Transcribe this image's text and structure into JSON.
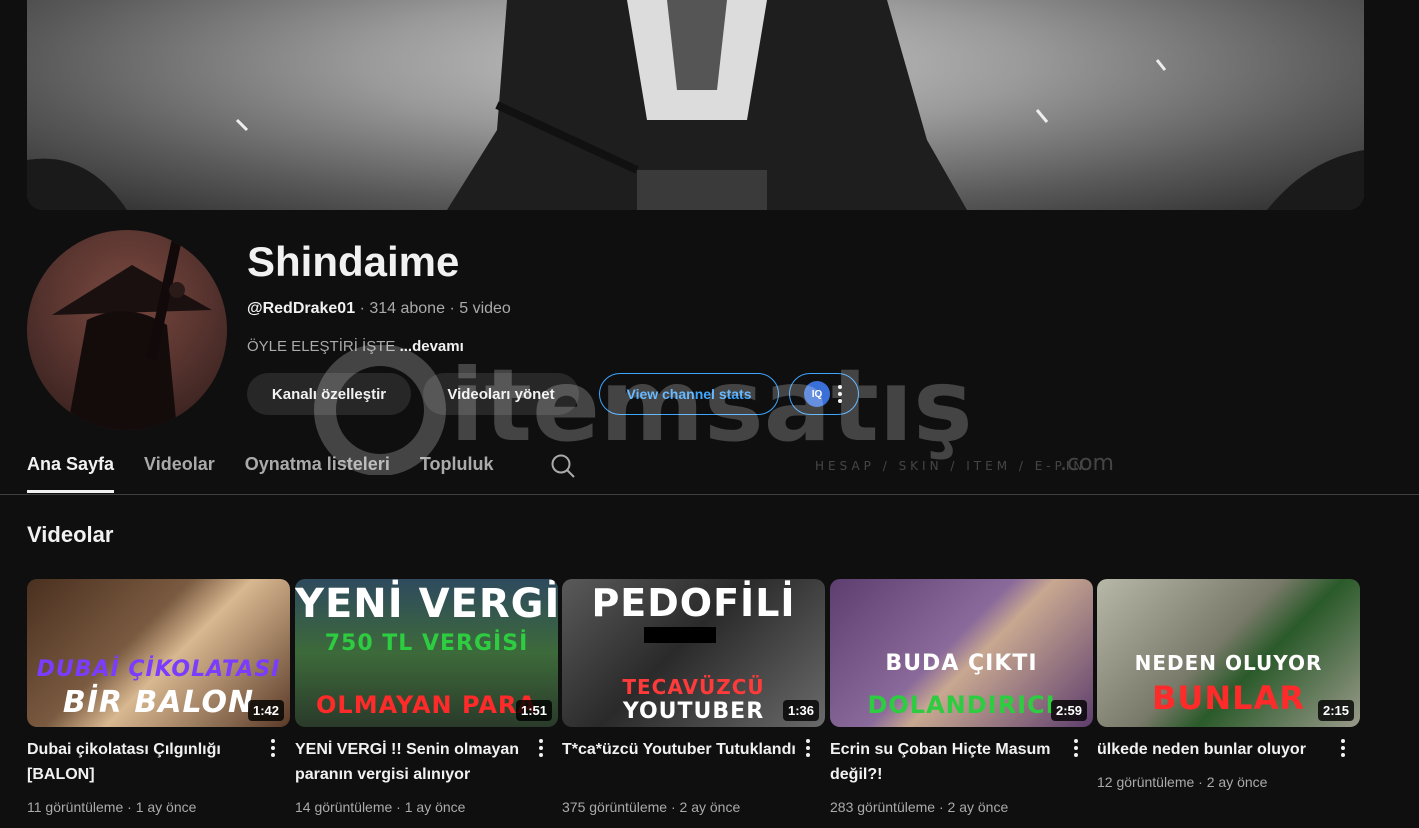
{
  "channel": {
    "name": "Shindaime",
    "handle": "@RedDrake01",
    "subscribers": "314 abone",
    "video_count": "5 video",
    "description": "ÖYLE ELEŞTİRİ İŞTE",
    "more_label": "...devamı"
  },
  "actions": {
    "customize_label": "Kanalı özelleştir",
    "manage_label": "Videoları yönet",
    "stats_label": "View channel stats",
    "extension_badge": "IQ"
  },
  "tabs": [
    {
      "label": "Ana Sayfa",
      "active": true
    },
    {
      "label": "Videolar",
      "active": false
    },
    {
      "label": "Oynatma listeleri",
      "active": false
    },
    {
      "label": "Topluluk",
      "active": false
    }
  ],
  "section_title": "Videolar",
  "watermark": {
    "brand": "itemsatış",
    "tagline": "HESAP / SKIN / ITEM / E-PIN",
    "suffix": ".com"
  },
  "videos": [
    {
      "title": "Dubai çikolatası Çılgınlığı [BALON]",
      "views": "11 görüntüleme",
      "age": "1 ay önce",
      "duration": "1:42",
      "caption_top": "DUBAİ ÇİKOLATASI",
      "caption_bottom": "BİR BALON",
      "bg": "#6a4a3a",
      "top_color": "#7a3cff",
      "bottom_color": "#ffffff"
    },
    {
      "title": "YENİ VERGİ !! Senin olmayan paranın vergisi alınıyor",
      "views": "14 görüntüleme",
      "age": "1 ay önce",
      "duration": "1:51",
      "caption_top": "YENİ VERGİ",
      "caption_mid": "750 TL VERGİSİ",
      "caption_bottom": "OLMAYAN PARA",
      "bg": "#3a5a3a",
      "top_color": "#ffffff",
      "bottom_color": "#ff2a2a"
    },
    {
      "title": "T*ca*üzcü Youtuber Tutuklandı",
      "views": "375 görüntüleme",
      "age": "2 ay önce",
      "duration": "1:36",
      "caption_top": "PEDOFİLİ",
      "caption_mid": "TECAVÜZCÜ",
      "caption_bottom": "YOUTUBER",
      "bg": "#4a4a4a",
      "top_color": "#ffffff",
      "bottom_color": "#ffffff"
    },
    {
      "title": "Ecrin su Çoban Hiçte Masum değil?!",
      "views": "283 görüntüleme",
      "age": "2 ay önce",
      "duration": "2:59",
      "caption_top": "BUDA        ÇIKTI",
      "caption_bottom": "DOLANDIRICI",
      "bg": "#7a5a8a",
      "top_color": "#ffffff",
      "bottom_color": "#2ecc40"
    },
    {
      "title": "ülkede neden bunlar oluyor",
      "views": "12 görüntüleme",
      "age": "2 ay önce",
      "duration": "2:15",
      "caption_top": "NEDEN    OLUYOR",
      "caption_bottom": "BUNLAR",
      "bg": "#8a8a6a",
      "top_color": "#ffffff",
      "bottom_color": "#ff2a2a"
    }
  ]
}
